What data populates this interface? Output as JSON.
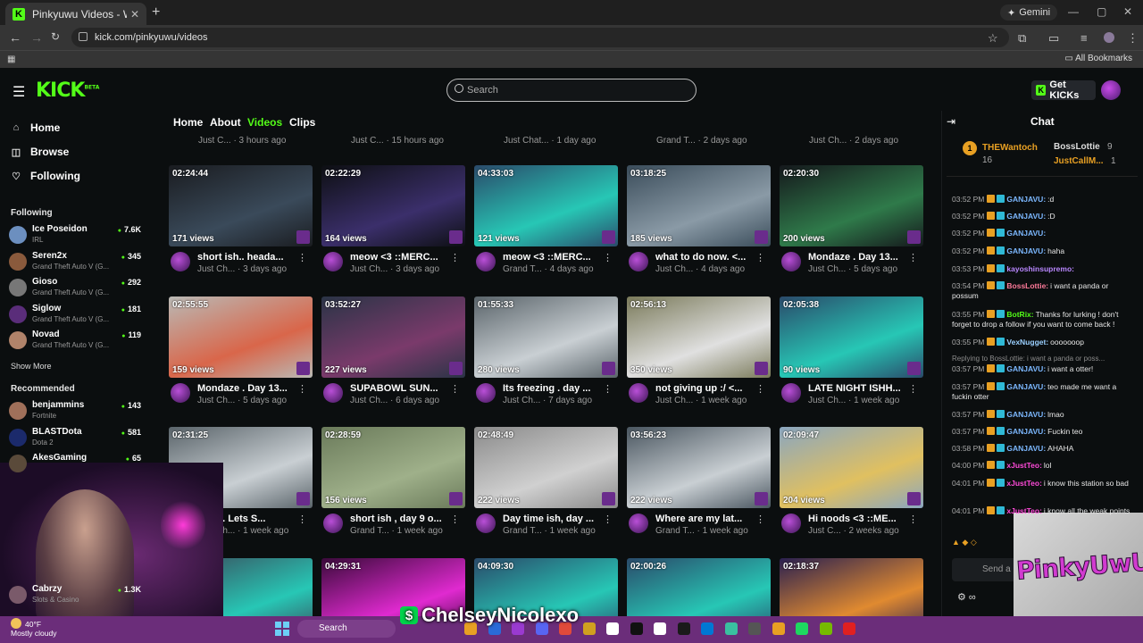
{
  "browser": {
    "tab_title": "Pinkyuwu Videos - Watch On-D",
    "url": "kick.com/pinkyuwu/videos",
    "gemini": "Gemini",
    "all_bookmarks": "All Bookmarks"
  },
  "kick": {
    "logo": "KICK",
    "beta": "BETA",
    "search_placeholder": "Search",
    "get_kicks": "Get KICKs"
  },
  "sidebar": {
    "nav": [
      "Home",
      "Browse",
      "Following"
    ],
    "following_title": "Following",
    "following": [
      {
        "name": "Ice Poseidon",
        "game": "IRL",
        "viewers": "7.6K",
        "color": "#6c8fbf"
      },
      {
        "name": "Seren2x",
        "game": "Grand Theft Auto V (G...",
        "viewers": "345",
        "color": "#8a5a3c"
      },
      {
        "name": "Gioso",
        "game": "Grand Theft Auto V (G...",
        "viewers": "292",
        "color": "#777777"
      },
      {
        "name": "Siglow",
        "game": "Grand Theft Auto V (G...",
        "viewers": "181",
        "color": "#5a2d7a"
      },
      {
        "name": "Novad",
        "game": "Grand Theft Auto V (G...",
        "viewers": "119",
        "color": "#b0836a"
      }
    ],
    "show_more": "Show More",
    "recommended_title": "Recommended",
    "recommended": [
      {
        "name": "benjammins",
        "game": "Fortnite",
        "viewers": "143",
        "color": "#a0705a"
      },
      {
        "name": "BLASTDota",
        "game": "Dota 2",
        "viewers": "581",
        "color": "#1b2a6b"
      },
      {
        "name": "AkesGaming",
        "game": "",
        "viewers": "65",
        "color": "#5a4a3a"
      },
      {
        "name": "Cabrzy",
        "game": "Slots & Casino",
        "viewers": "1.3K",
        "color": "#7a5a6a"
      }
    ]
  },
  "tabs": [
    "Home",
    "About",
    "Videos",
    "Clips"
  ],
  "top_row": [
    {
      "ch": "Just C...",
      "ago": "3 hours ago"
    },
    {
      "ch": "Just C...",
      "ago": "15 hours ago"
    },
    {
      "ch": "Just Chat...",
      "ago": "1 day ago"
    },
    {
      "ch": "Grand T...",
      "ago": "2 days ago"
    },
    {
      "ch": "Just Ch...",
      "ago": "2 days ago"
    }
  ],
  "videos": [
    {
      "duration": "02:24:44",
      "views": "171 views",
      "title": "short ish.. heada...",
      "ch": "Just Ch...",
      "ago": "3 days ago",
      "bg": "#1a1c20",
      "accent": "#3a4a5a"
    },
    {
      "duration": "02:22:29",
      "views": "164 views",
      "title": "meow <3 ::MERC...",
      "ch": "Just Ch...",
      "ago": "3 days ago",
      "bg": "#0d0f12",
      "accent": "#3b2f6b"
    },
    {
      "duration": "04:33:03",
      "views": "121 views",
      "title": "meow <3 ::MERC...",
      "ch": "Grand T...",
      "ago": "4 days ago",
      "bg": "#2a4a6a",
      "accent": "#27c7b5"
    },
    {
      "duration": "03:18:25",
      "views": "185 views",
      "title": "what to do now. <...",
      "ch": "Just Ch...",
      "ago": "4 days ago",
      "bg": "#3a4c5a",
      "accent": "#8a9aa6"
    },
    {
      "duration": "02:20:30",
      "views": "200 views",
      "title": "Mondaze . Day 13...",
      "ch": "Just Ch...",
      "ago": "5 days ago",
      "bg": "#15181c",
      "accent": "#2f7a4a"
    },
    {
      "duration": "02:55:55",
      "views": "159 views",
      "title": "Mondaze . Day 13...",
      "ch": "Just Ch...",
      "ago": "5 days ago",
      "bg": "#b9b9b5",
      "accent": "#d9664a"
    },
    {
      "duration": "03:52:27",
      "views": "227 views",
      "title": "SUPABOWL SUN...",
      "ch": "Just Ch...",
      "ago": "6 days ago",
      "bg": "#2a3446",
      "accent": "#7a3a6b"
    },
    {
      "duration": "01:55:33",
      "views": "280 views",
      "title": "Its freezing . day ...",
      "ch": "Just Ch...",
      "ago": "7 days ago",
      "bg": "#5a646a",
      "accent": "#c9cfd3"
    },
    {
      "duration": "02:56:13",
      "views": "350 views",
      "title": "not giving up :/ <...",
      "ch": "Just Ch...",
      "ago": "1 week ago",
      "bg": "#7a7a5a",
      "accent": "#e0e0e0"
    },
    {
      "duration": "02:05:38",
      "views": "90 views",
      "title": "LATE NIGHT ISHH...",
      "ch": "Just Ch...",
      "ago": "1 week ago",
      "bg": "#2a4a6a",
      "accent": "#27c7b5"
    },
    {
      "duration": "02:31:25",
      "views": "",
      "title": "y Ish . Lets S...",
      "ch": "Just Ch...",
      "ago": "1 week ago",
      "bg": "#5a646a",
      "accent": "#c9cfd3"
    },
    {
      "duration": "02:28:59",
      "views": "156 views",
      "title": "short ish , day 9 o...",
      "ch": "Grand T...",
      "ago": "1 week ago",
      "bg": "#6a7a5a",
      "accent": "#9fb08a"
    },
    {
      "duration": "02:48:49",
      "views": "222 views",
      "title": "Day time ish, day ...",
      "ch": "Grand T...",
      "ago": "1 week ago",
      "bg": "#8a8a8a",
      "accent": "#d0d0d0"
    },
    {
      "duration": "03:56:23",
      "views": "222 views",
      "title": "Where are my lat...",
      "ch": "Grand T...",
      "ago": "1 week ago",
      "bg": "#4a5660",
      "accent": "#c9cfd3"
    },
    {
      "duration": "02:09:47",
      "views": "204 views",
      "title": "Hi noods <3 ::ME...",
      "ch": "Just C...",
      "ago": "2 weeks ago",
      "bg": "#8aa6c0",
      "accent": "#e0c060"
    },
    {
      "duration": "",
      "views": "",
      "title": "",
      "ch": "",
      "ago": "",
      "bg": "#3a4a5a",
      "accent": "#27c7b5"
    },
    {
      "duration": "04:29:31",
      "views": "",
      "title": "",
      "ch": "",
      "ago": "",
      "bg": "#3a0a3a",
      "accent": "#e02ad0"
    },
    {
      "duration": "04:09:30",
      "views": "",
      "title": "",
      "ch": "",
      "ago": "",
      "bg": "#2a4a6a",
      "accent": "#27c7b5"
    },
    {
      "duration": "02:00:26",
      "views": "",
      "title": "",
      "ch": "",
      "ago": "",
      "bg": "#2a4a6a",
      "accent": "#27c7b5"
    },
    {
      "duration": "02:18:37",
      "views": "",
      "title": "",
      "ch": "",
      "ago": "",
      "bg": "#2a2050",
      "accent": "#e08a30"
    }
  ],
  "chat": {
    "title": "Chat",
    "leader": {
      "rank": "1",
      "name": "THEWantoch",
      "count": "16",
      "second": "BossLottie",
      "second_count": "9",
      "third": "JustCallM...",
      "third_count": "1"
    },
    "messages": [
      {
        "time": "03:52 PM",
        "user": "GANJAVU:",
        "text": ":d",
        "color": "#7cb8ff"
      },
      {
        "time": "03:52 PM",
        "user": "GANJAVU:",
        "text": ":D",
        "color": "#7cb8ff"
      },
      {
        "time": "03:52 PM",
        "user": "GANJAVU:",
        "text": "",
        "color": "#7cb8ff"
      },
      {
        "time": "03:52 PM",
        "user": "GANJAVU:",
        "text": "haha",
        "color": "#7cb8ff"
      },
      {
        "time": "03:53 PM",
        "user": "kayoshinsupremo:",
        "text": "",
        "color": "#b987ff"
      },
      {
        "time": "03:54 PM",
        "user": "BossLottie:",
        "text": "i want a panda or possum",
        "color": "#ff7a9a"
      },
      {
        "time": "03:55 PM",
        "user": "BotRix:",
        "text": "Thanks for lurking ! don't forget to drop a follow if you want to come back !",
        "color": "#53fc18"
      },
      {
        "time": "03:55 PM",
        "user": "VexNugget:",
        "text": "ooooooop",
        "color": "#9ad0ff"
      },
      {
        "time": "03:57 PM",
        "user": "GANJAVU:",
        "text": "i want a otter!",
        "color": "#7cb8ff"
      },
      {
        "time": "03:57 PM",
        "user": "GANJAVU:",
        "text": "teo made me want a fuckin otter",
        "color": "#7cb8ff"
      },
      {
        "time": "03:57 PM",
        "user": "GANJAVU:",
        "text": "lmao",
        "color": "#7cb8ff"
      },
      {
        "time": "03:57 PM",
        "user": "GANJAVU:",
        "text": "Fuckin teo",
        "color": "#7cb8ff"
      },
      {
        "time": "03:58 PM",
        "user": "GANJAVU:",
        "text": "AHAHA",
        "color": "#7cb8ff"
      },
      {
        "time": "04:00 PM",
        "user": "xJustTeo:",
        "text": "lol",
        "color": "#ff4ad9"
      },
      {
        "time": "04:01 PM",
        "user": "xJustTeo:",
        "text": "i know this station so bad",
        "color": "#ff4ad9"
      },
      {
        "time": "04:01 PM",
        "user": "xJustTeo:",
        "text": "i know all the weak points",
        "color": "#ff4ad9"
      }
    ],
    "reply_hint": "Replying to BossLottie: i want a panda or poss...",
    "send_placeholder": "Send a"
  },
  "overlay": {
    "cashtag": "ChelseyNicolexo",
    "logo_text": "PinkyUwU"
  },
  "taskbar": {
    "temp": "40°F",
    "condition": "Mostly cloudy",
    "search": "Search"
  }
}
